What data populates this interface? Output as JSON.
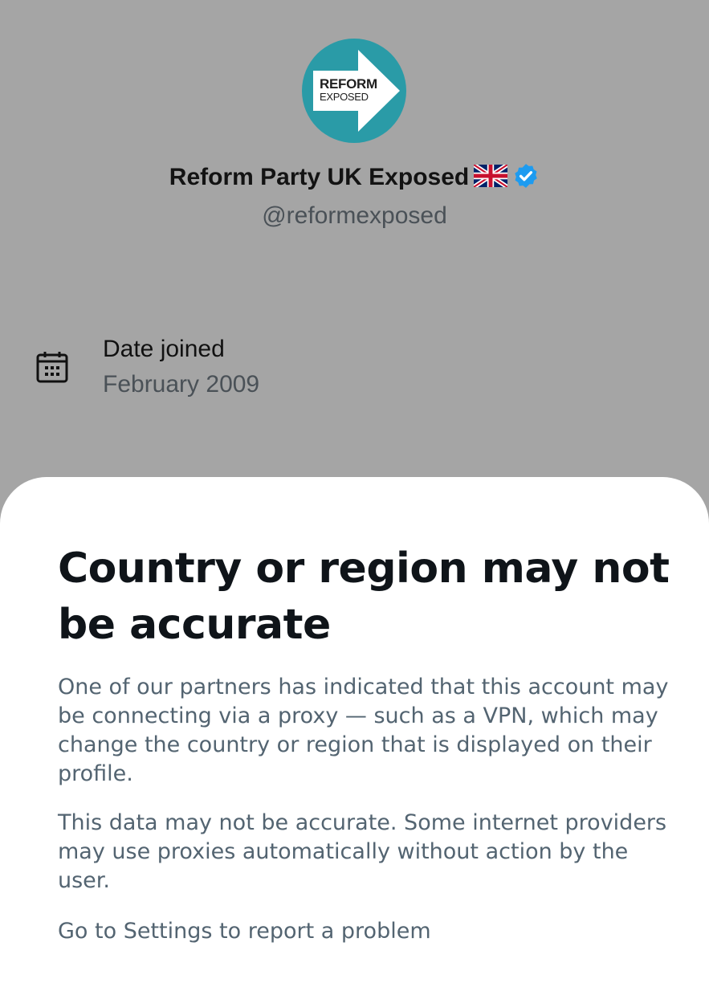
{
  "profile": {
    "avatar_logo_line1": "REFORM",
    "avatar_logo_line2": "EXPOSED",
    "display_name": "Reform Party UK Exposed",
    "flag": "uk-flag-icon",
    "verified": "verified-badge-icon",
    "handle": "@reformexposed"
  },
  "joined": {
    "icon": "calendar-icon",
    "label": "Date joined",
    "value": "February 2009"
  },
  "sheet": {
    "title": "Country or region may not be accurate",
    "paragraph1": "One of our partners has indicated that this account may be connecting via a proxy — such as a VPN, which may change the country or region that is displayed on their profile.",
    "paragraph2": "This data may not be accurate. Some internet providers may use proxies automatically without action by the user.",
    "settings_link": "Go to Settings to report a problem"
  },
  "colors": {
    "overlay": "#a5a5a5",
    "avatar_teal": "#2a9ba7",
    "verified_blue": "#1d9bf0",
    "title": "#0f1419",
    "secondary_text": "#536471"
  }
}
